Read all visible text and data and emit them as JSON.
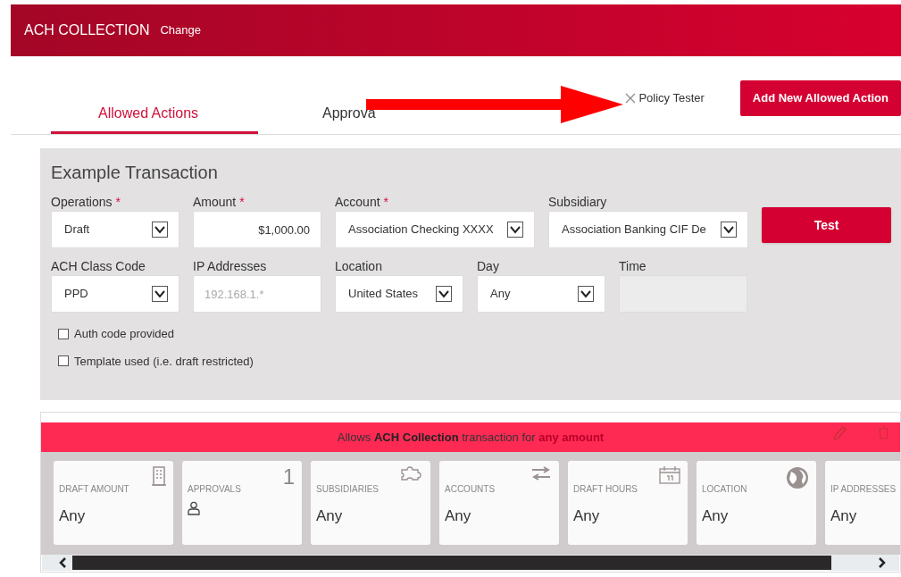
{
  "header": {
    "title": "ACH COLLECTION",
    "link": "Change"
  },
  "tabs": [
    {
      "label": "Allowed Actions",
      "selected": true
    },
    {
      "label": "Approva",
      "selected": false
    }
  ],
  "policy_tester": "Policy Tester",
  "add_button": "Add New Allowed Action",
  "example": {
    "title": "Example Transaction",
    "fields": [
      {
        "kind": "select",
        "label": "Operations",
        "required_mark": "*",
        "value": "Draft"
      },
      {
        "kind": "text",
        "label": "Amount",
        "required_mark": "*",
        "value": "$1,000.00"
      },
      {
        "kind": "select",
        "label": "Account",
        "required_mark": "*",
        "value": "Association Checking XXXX"
      },
      {
        "kind": "select",
        "label": "Subsidiary",
        "value": "Association Banking CIF De"
      },
      {
        "kind": "select",
        "label": "ACH Class Code",
        "value": "PPD"
      },
      {
        "kind": "text",
        "label": "IP Addresses",
        "placeholder": "192.168.1.*"
      },
      {
        "kind": "select",
        "label": "Location",
        "value": "United States"
      },
      {
        "kind": "select",
        "label": "Day",
        "value": "Any"
      },
      {
        "kind": "text",
        "label": "Time",
        "disabled": true
      }
    ],
    "test_button": "Test",
    "checkboxes": [
      {
        "label": "Auth code provided",
        "checked": false
      },
      {
        "label": "Template used (i.e. draft restricted)",
        "checked": false
      }
    ]
  },
  "rule": {
    "banner": "Allows **ACH Collection** transaction for **any amount**",
    "cards": [
      {
        "label": "DRAFT AMOUNT",
        "value": "Any"
      },
      {
        "label": "APPROVALS",
        "count": "1"
      },
      {
        "label": "SUBSIDIARIES",
        "value": "Any"
      },
      {
        "label": "ACCOUNTS",
        "value": "Any"
      },
      {
        "label": "DRAFT HOURS",
        "value": "Any"
      },
      {
        "label": "LOCATION",
        "value": "Any"
      },
      {
        "label": "IP ADDRESSES",
        "value": "Any"
      }
    ]
  }
}
